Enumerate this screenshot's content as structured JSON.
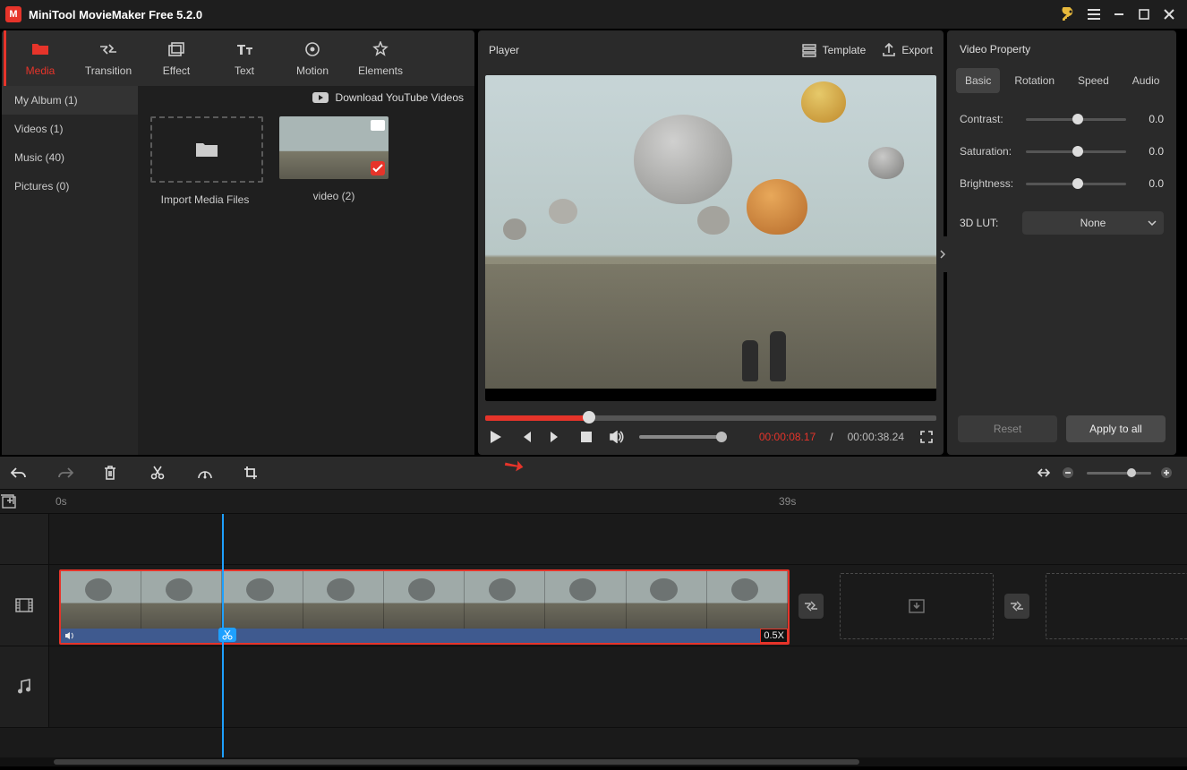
{
  "titlebar": {
    "app_name": "MiniTool MovieMaker Free 5.2.0"
  },
  "ribbon": [
    {
      "label": "Media",
      "active": true
    },
    {
      "label": "Transition"
    },
    {
      "label": "Effect"
    },
    {
      "label": "Text"
    },
    {
      "label": "Motion"
    },
    {
      "label": "Elements"
    }
  ],
  "sidebar": [
    {
      "label": "My Album (1)",
      "active": true
    },
    {
      "label": "Videos (1)"
    },
    {
      "label": "Music (40)"
    },
    {
      "label": "Pictures (0)"
    }
  ],
  "download_label": "Download YouTube Videos",
  "media": {
    "import_label": "Import Media Files",
    "clip_label": "video (2)"
  },
  "player": {
    "title": "Player",
    "template_label": "Template",
    "export_label": "Export",
    "time_current": "00:00:08.17",
    "time_sep": " / ",
    "time_total": "00:00:38.24"
  },
  "props": {
    "title": "Video Property",
    "tabs": [
      "Basic",
      "Rotation",
      "Speed",
      "Audio"
    ],
    "contrast": {
      "label": "Contrast:",
      "value": "0.0"
    },
    "saturation": {
      "label": "Saturation:",
      "value": "0.0"
    },
    "brightness": {
      "label": "Brightness:",
      "value": "0.0"
    },
    "lut_label": "3D LUT:",
    "lut_value": "None",
    "reset_label": "Reset",
    "apply_label": "Apply to all"
  },
  "timeline": {
    "start_label": "0s",
    "end_label": "39s",
    "speed_badge": "0.5X"
  }
}
